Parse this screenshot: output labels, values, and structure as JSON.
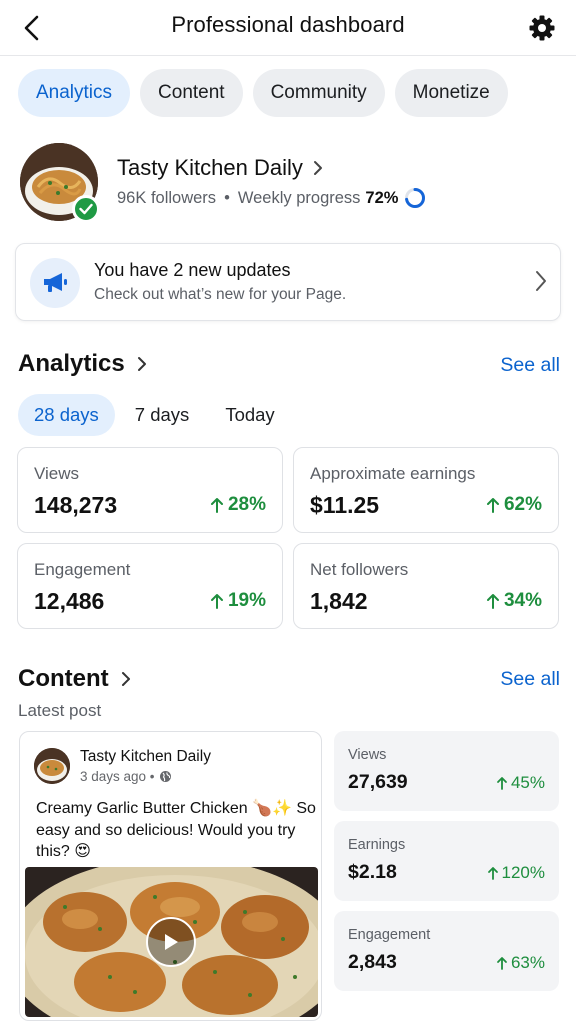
{
  "header": {
    "title": "Professional dashboard",
    "back_icon": "back-arrow-icon",
    "settings_icon": "gear-icon"
  },
  "tabs": [
    {
      "label": "Analytics",
      "active": true
    },
    {
      "label": "Content",
      "active": false
    },
    {
      "label": "Community",
      "active": false
    },
    {
      "label": "Monetize",
      "active": false
    }
  ],
  "profile": {
    "name": "Tasty Kitchen Daily",
    "followers": "96K followers",
    "separator": "•",
    "progress_label": "Weekly progress",
    "progress_value": "72%",
    "progress_fraction": 0.72
  },
  "updates": {
    "title": "You have 2 new updates",
    "subtitle": "Check out what’s new for your Page."
  },
  "analytics": {
    "title": "Analytics",
    "see_all": "See all",
    "ranges": [
      {
        "label": "28 days",
        "active": true
      },
      {
        "label": "7 days",
        "active": false
      },
      {
        "label": "Today",
        "active": false
      }
    ],
    "metrics": [
      {
        "label": "Views",
        "value": "148,273",
        "change": "28%"
      },
      {
        "label": "Approximate earnings",
        "value": "$11.25",
        "change": "62%"
      },
      {
        "label": "Engagement",
        "value": "12,486",
        "change": "19%"
      },
      {
        "label": "Net followers",
        "value": "1,842",
        "change": "34%"
      }
    ]
  },
  "content": {
    "title": "Content",
    "see_all": "See all",
    "latest_label": "Latest post",
    "post": {
      "author": "Tasty Kitchen Daily",
      "time": "3 days ago •",
      "text": "Creamy Garlic Butter Chicken 🍗✨ So easy and so delicious! Would you try this? 😍"
    },
    "stats": [
      {
        "label": "Views",
        "value": "27,639",
        "change": "45%"
      },
      {
        "label": "Earnings",
        "value": "$2.18",
        "change": "120%"
      },
      {
        "label": "Engagement",
        "value": "2,843",
        "change": "63%"
      }
    ]
  },
  "colors": {
    "accent": "#0b63ce",
    "positive": "#1e8e3e",
    "verified": "#1f9a44"
  }
}
